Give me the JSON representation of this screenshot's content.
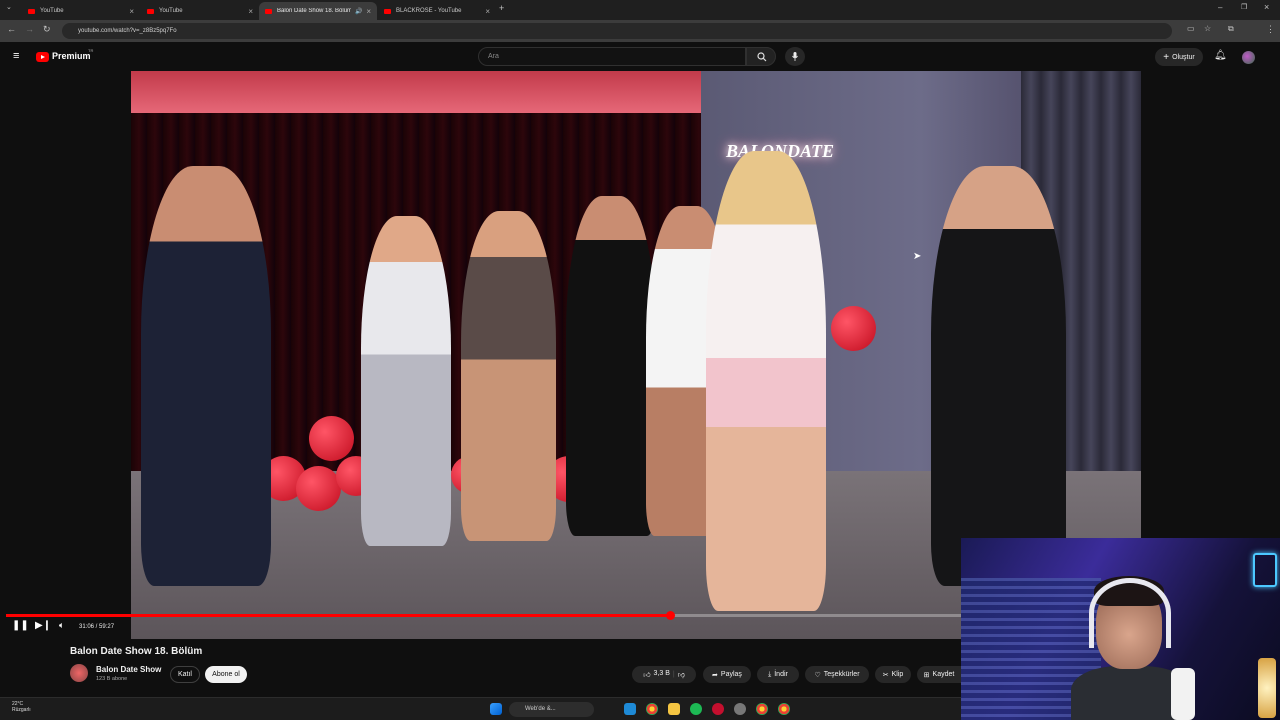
{
  "browser": {
    "tabs": [
      {
        "label": "YouTube",
        "active": false
      },
      {
        "label": "YouTube",
        "active": false
      },
      {
        "label": "Balon Date Show 18. Bölüm",
        "active": true
      },
      {
        "label": "BLACKROSE - YouTube",
        "active": false
      }
    ],
    "url": "youtube.com/watch?v=_z8Bz5pq7Fo"
  },
  "header": {
    "logo_text": "Premium",
    "logo_sup": "TR",
    "search_placeholder": "Ara",
    "create_label": "Oluştur"
  },
  "player": {
    "time": "31:06 / 59:27",
    "progress": 0.695
  },
  "video_info": {
    "title": "Balon Date Show 18. Bölüm",
    "channel_name": "Balon Date Show",
    "channel_subs": "123 B abone",
    "join_label": "Katıl",
    "subscribe_label": "Abone ol",
    "likes": "3,3 B",
    "share_label": "Paylaş",
    "download_label": "İndir",
    "thanks_label": "Teşekkürler",
    "clip_label": "Klip",
    "save_label": "Kaydet"
  },
  "taskbar": {
    "temperature": "22°C",
    "weather_label": "Rüzgarlı",
    "search_label": "Web'de &..."
  },
  "colors": {
    "youtube_red": "#ff0000",
    "background": "#0f0f0f"
  }
}
